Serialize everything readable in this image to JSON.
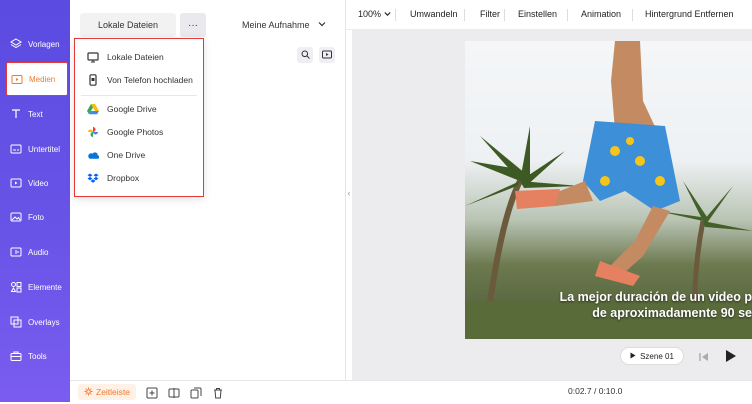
{
  "sidebar": {
    "items": [
      {
        "label": "Vorlagen",
        "icon": "layers-icon"
      },
      {
        "label": "Medien",
        "icon": "media-folder-icon",
        "active": true
      },
      {
        "label": "Text",
        "icon": "text-icon"
      },
      {
        "label": "Untertitel",
        "icon": "subtitle-icon"
      },
      {
        "label": "Video",
        "icon": "video-icon"
      },
      {
        "label": "Foto",
        "icon": "photo-icon"
      },
      {
        "label": "Audio",
        "icon": "audio-icon"
      },
      {
        "label": "Elemente",
        "icon": "elements-icon"
      },
      {
        "label": "Overlays",
        "icon": "overlays-icon"
      },
      {
        "label": "Tools",
        "icon": "tools-icon"
      }
    ]
  },
  "panel": {
    "tab_local": "Lokale Dateien",
    "tab_more": "···",
    "tab_recording": "Meine Aufnahme",
    "dropdown": [
      {
        "label": "Lokale Dateien",
        "icon": "monitor-icon"
      },
      {
        "label": "Von Telefon hochladen",
        "icon": "phone-icon"
      },
      {
        "label": "Google Drive",
        "icon": "google-drive-icon"
      },
      {
        "label": "Google Photos",
        "icon": "google-photos-icon"
      },
      {
        "label": "One Drive",
        "icon": "onedrive-icon"
      },
      {
        "label": "Dropbox",
        "icon": "dropbox-icon"
      }
    ]
  },
  "toolbar": {
    "zoom": "100%",
    "items": [
      "Umwandeln",
      "Filter",
      "Einstellen",
      "Animation",
      "Hintergrund Entfernen"
    ]
  },
  "preview": {
    "caption_line1": "La mejor duración de un video p",
    "caption_line2": "de aproximadamente 90 se",
    "scene_label": "Szene 01"
  },
  "bottombar": {
    "timeline_label": "Zeitleiste",
    "time": "0:02.7 / 0:10.0"
  },
  "colors": {
    "sidebar": "#5b4be0",
    "accent": "#f07a2a",
    "highlight": "#e53935"
  }
}
